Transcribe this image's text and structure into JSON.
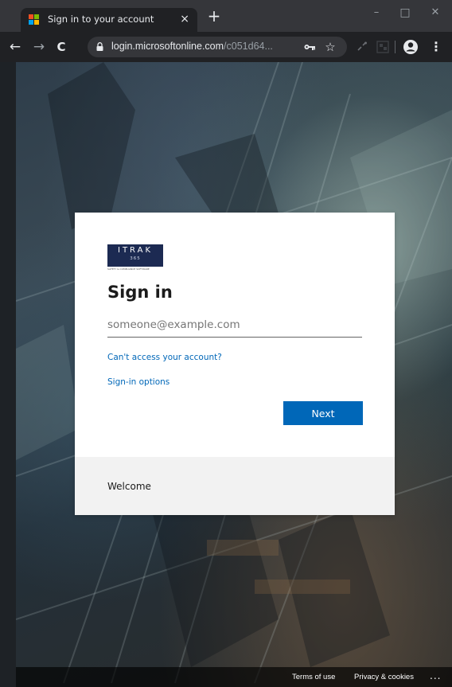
{
  "browser": {
    "tab": {
      "title": "Sign in to your account",
      "close": "×",
      "favicon": "microsoft-logo-icon"
    },
    "new_tab": "+",
    "window_controls": {
      "minimize": "–",
      "maximize": "□",
      "close": "✕"
    },
    "nav": {
      "back": "←",
      "forward": "→",
      "reload": "C"
    },
    "address": {
      "domain": "login.microsoftonline.com",
      "path": "/c051d64..."
    },
    "omnibox_icons": [
      "key-icon",
      "star-icon"
    ],
    "toolbar_icons": [
      "extension-icon",
      "extension-grid-icon"
    ],
    "profile_icon": "account-circle-icon",
    "menu": "⋮"
  },
  "signin": {
    "logo": {
      "name": "ITRAK",
      "sub": "365",
      "tagline": "SAFETY & COMPLIANCE SOFTWARE"
    },
    "title": "Sign in",
    "email_placeholder": "someone@example.com",
    "email_value": "",
    "cant_access_link": "Can't access your account?",
    "signin_options_link": "Sign-in options",
    "next_button": "Next",
    "welcome": "Welcome"
  },
  "footer": {
    "terms": "Terms of use",
    "privacy": "Privacy & cookies",
    "more": "..."
  },
  "colors": {
    "accent": "#0067b8",
    "browser_frame": "#35363a",
    "browser_toolbar": "#202124",
    "logo_navy": "#1c2a52"
  }
}
